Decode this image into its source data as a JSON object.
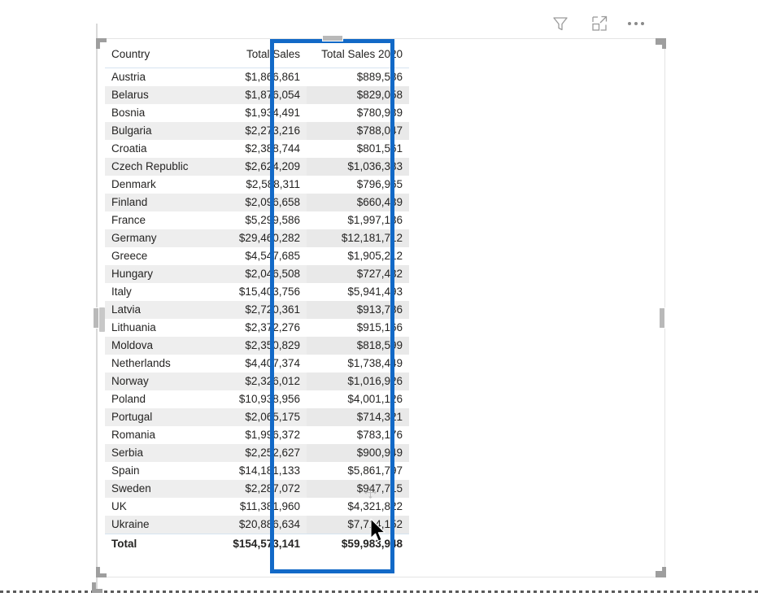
{
  "visual": {
    "type": "table-visual",
    "toolbar": {
      "filter_label": "Filters",
      "focus_label": "Focus mode",
      "more_label": "More options"
    },
    "selected_column": "Total Sales 2020",
    "accent_color": "#1269c7"
  },
  "table": {
    "columns": [
      {
        "key": "country",
        "label": "Country",
        "align": "left"
      },
      {
        "key": "total_sales",
        "label": "Total Sales",
        "align": "right"
      },
      {
        "key": "total_sales_2020",
        "label": "Total Sales 2020",
        "align": "right"
      }
    ],
    "rows": [
      {
        "country": "Austria",
        "total_sales": "$1,866,861",
        "total_sales_2020": "$889,586"
      },
      {
        "country": "Belarus",
        "total_sales": "$1,876,054",
        "total_sales_2020": "$829,058"
      },
      {
        "country": "Bosnia",
        "total_sales": "$1,934,491",
        "total_sales_2020": "$780,939"
      },
      {
        "country": "Bulgaria",
        "total_sales": "$2,273,216",
        "total_sales_2020": "$788,047"
      },
      {
        "country": "Croatia",
        "total_sales": "$2,388,744",
        "total_sales_2020": "$801,561"
      },
      {
        "country": "Czech Republic",
        "total_sales": "$2,624,209",
        "total_sales_2020": "$1,036,383"
      },
      {
        "country": "Denmark",
        "total_sales": "$2,588,311",
        "total_sales_2020": "$796,965"
      },
      {
        "country": "Finland",
        "total_sales": "$2,096,658",
        "total_sales_2020": "$660,439"
      },
      {
        "country": "France",
        "total_sales": "$5,299,586",
        "total_sales_2020": "$1,997,136"
      },
      {
        "country": "Germany",
        "total_sales": "$29,460,282",
        "total_sales_2020": "$12,181,712"
      },
      {
        "country": "Greece",
        "total_sales": "$4,547,685",
        "total_sales_2020": "$1,905,212"
      },
      {
        "country": "Hungary",
        "total_sales": "$2,046,508",
        "total_sales_2020": "$727,432"
      },
      {
        "country": "Italy",
        "total_sales": "$15,403,756",
        "total_sales_2020": "$5,941,493"
      },
      {
        "country": "Latvia",
        "total_sales": "$2,720,361",
        "total_sales_2020": "$913,786"
      },
      {
        "country": "Lithuania",
        "total_sales": "$2,372,276",
        "total_sales_2020": "$915,166"
      },
      {
        "country": "Moldova",
        "total_sales": "$2,350,829",
        "total_sales_2020": "$818,599"
      },
      {
        "country": "Netherlands",
        "total_sales": "$4,407,374",
        "total_sales_2020": "$1,738,449"
      },
      {
        "country": "Norway",
        "total_sales": "$2,326,012",
        "total_sales_2020": "$1,016,926"
      },
      {
        "country": "Poland",
        "total_sales": "$10,938,956",
        "total_sales_2020": "$4,001,126"
      },
      {
        "country": "Portugal",
        "total_sales": "$2,065,175",
        "total_sales_2020": "$714,321"
      },
      {
        "country": "Romania",
        "total_sales": "$1,996,372",
        "total_sales_2020": "$783,176"
      },
      {
        "country": "Serbia",
        "total_sales": "$2,252,627",
        "total_sales_2020": "$900,949"
      },
      {
        "country": "Spain",
        "total_sales": "$14,181,133",
        "total_sales_2020": "$5,861,797"
      },
      {
        "country": "Sweden",
        "total_sales": "$2,287,072",
        "total_sales_2020": "$947,715"
      },
      {
        "country": "UK",
        "total_sales": "$11,381,960",
        "total_sales_2020": "$4,321,822"
      },
      {
        "country": "Ukraine",
        "total_sales": "$20,886,634",
        "total_sales_2020": "$7,714,152"
      }
    ],
    "total_row": {
      "country": "Total",
      "total_sales": "$154,573,141",
      "total_sales_2020": "$59,983,948"
    }
  }
}
